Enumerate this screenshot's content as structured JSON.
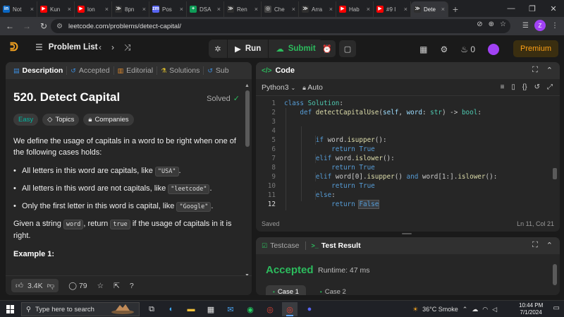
{
  "browser": {
    "tabs": [
      {
        "label": "Not",
        "fav_color": "#0a66c2",
        "fav_text": "in"
      },
      {
        "label": "Kun",
        "fav_color": "#ff0000",
        "fav_text": "▶"
      },
      {
        "label": "lon",
        "fav_color": "#ff0000",
        "fav_text": "▶"
      },
      {
        "label": "8pn",
        "fav_color": "#2f2f2f",
        "fav_text": "≫"
      },
      {
        "label": "Pos",
        "fav_color": "#5865f2",
        "fav_text": "zm"
      },
      {
        "label": "DSA",
        "fav_color": "#0f9d58",
        "fav_text": "+"
      },
      {
        "label": "Ren",
        "fav_color": "#2f2f2f",
        "fav_text": "≫"
      },
      {
        "label": "Che",
        "fav_color": "#444444",
        "fav_text": "◎"
      },
      {
        "label": "Arra",
        "fav_color": "#2f2f2f",
        "fav_text": "≫"
      },
      {
        "label": "Hab",
        "fav_color": "#ff0000",
        "fav_text": "▶"
      },
      {
        "label": "#9 I",
        "fav_color": "#ff0000",
        "fav_text": "▶"
      },
      {
        "label": "Dete",
        "fav_color": "#2f2f2f",
        "fav_text": "≫",
        "active": true
      }
    ],
    "url": "leetcode.com/problems/detect-capital/",
    "profile_letter": "Z"
  },
  "lcnav": {
    "problem_list": "Problem List",
    "run": "Run",
    "submit": "Submit",
    "streak": "0",
    "premium": "Premium"
  },
  "left": {
    "tabs": [
      "Description",
      "Accepted",
      "Editorial",
      "Solutions",
      "Sub"
    ],
    "title": "520. Detect Capital",
    "solved": "Solved",
    "tags": [
      "Easy",
      "Topics",
      "Companies"
    ],
    "desc_1": "We define the usage of capitals in a word to be right when one of the following cases holds:",
    "bullets": [
      {
        "text": "All letters in this word are capitals, like ",
        "code": "\"USA\"",
        "after": "."
      },
      {
        "text": "All letters in this word are not capitals, like ",
        "code": "\"leetcode\"",
        "after": "."
      },
      {
        "text": "Only the first letter in this word is capital, like ",
        "code": "\"Google\"",
        "after": "."
      }
    ],
    "given_pre": "Given a string ",
    "given_code1": "word",
    "given_mid": ", return ",
    "given_code2": "true",
    "given_post": " if the usage of capitals in it is right.",
    "example": "Example 1:",
    "likes": "3.4K",
    "comments": "79"
  },
  "code": {
    "title": "Code",
    "language": "Python3",
    "mode": "Auto",
    "status": "Saved",
    "cursor": "Ln 11, Col 21",
    "line_numbers": [
      "1",
      "2",
      "3",
      "4",
      "5",
      "6",
      "7",
      "8",
      "9",
      "10",
      "11",
      "12"
    ]
  },
  "result": {
    "tab_testcase": "Testcase",
    "tab_result": "Test Result",
    "verdict": "Accepted",
    "runtime": "Runtime: 47 ms",
    "cases": [
      "Case 1",
      "Case 2"
    ]
  },
  "taskbar": {
    "search_placeholder": "Type here to search",
    "weather": "36°C  Smoke",
    "time": "10:44 PM",
    "date": "7/1/2024"
  }
}
